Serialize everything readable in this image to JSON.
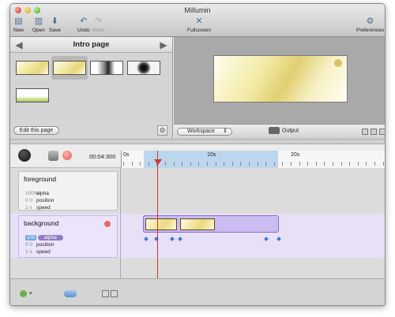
{
  "window": {
    "title": "Millumin"
  },
  "toolbar": {
    "new_label": "New",
    "open_label": "Open",
    "save_label": "Save",
    "undo_label": "Undo",
    "redo_label": "Redo",
    "fullscreen_label": "Fullscreen",
    "preferences_label": "Preferences"
  },
  "page_nav": {
    "title": "Intro page",
    "edit_label": "Edit this page"
  },
  "preview_controls": {
    "workspace_label": "Workspace",
    "output_label": "Output"
  },
  "timeline": {
    "time": "00:04:300",
    "ruler_labels": [
      "0s",
      "10s",
      "20s"
    ]
  },
  "tracks": [
    {
      "name": "foreground",
      "props": [
        {
          "value": "100%",
          "label": "alpha"
        },
        {
          "value": "0 0",
          "label": "position"
        },
        {
          "value": "1 x",
          "label": "speed"
        }
      ]
    },
    {
      "name": "background",
      "props": [
        {
          "value": "100",
          "label": "alpha"
        },
        {
          "value": "0 0",
          "label": "position"
        },
        {
          "value": "1 x",
          "label": "speed"
        }
      ]
    }
  ],
  "colors": {
    "playhead": "#d0362b",
    "clip_group": "#cbbcf2",
    "ruler_highlight": "#bcd6ee",
    "keyframe": "#3a7ad8"
  },
  "icons": [
    "new-doc-icon",
    "open-folder-icon",
    "save-icon",
    "undo-icon",
    "redo-icon",
    "fullscreen-icon",
    "preferences-icon",
    "arrow-left-icon",
    "arrow-right-icon",
    "gear-icon",
    "camera-icon",
    "record-icon",
    "play-icon"
  ]
}
